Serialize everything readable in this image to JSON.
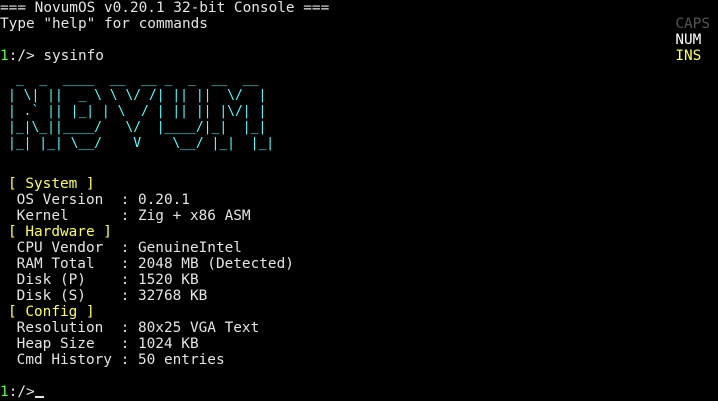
{
  "header": {
    "title": "=== NovumOS v0.20.1 32-bit Console ===",
    "help": "Type \"help\" for commands"
  },
  "indicators": {
    "caps": "CAPS",
    "num": "NUM",
    "ins": "INS"
  },
  "prompt": {
    "number": "1",
    "symbol": ":/> ",
    "command": "sysinfo"
  },
  "logo": {
    "lines": [
      " _  _  ____  __  __ _  _  __  __",
      "| \\| ||  _ \\ \\ \\/ /| || ||  \\/  |",
      "| .` || |_| | \\  / | || || |\\/| |",
      "|_|\\_||____/   \\/  |____/|_|  |_|",
      "|_| |_| \\__/    V    \\__/ |_|  |_|"
    ]
  },
  "sections": [
    {
      "title": "[ System ]",
      "rows": [
        {
          "label": " OS Version  ",
          "sep": ": ",
          "value": "0.20.1"
        },
        {
          "label": " Kernel      ",
          "sep": ": ",
          "value": "Zig + x86 ASM"
        }
      ]
    },
    {
      "title": "[ Hardware ]",
      "rows": [
        {
          "label": " CPU Vendor  ",
          "sep": ": ",
          "value": "GenuineIntel"
        },
        {
          "label": " RAM Total   ",
          "sep": ": ",
          "value": "2048 MB (Detected)"
        },
        {
          "label": " Disk (P)    ",
          "sep": ": ",
          "value": "1520 KB"
        },
        {
          "label": " Disk (S)    ",
          "sep": ": ",
          "value": "32768 KB"
        }
      ]
    },
    {
      "title": "[ Config ]",
      "rows": [
        {
          "label": " Resolution  ",
          "sep": ": ",
          "value": "80x25 VGA Text"
        },
        {
          "label": " Heap Size   ",
          "sep": ": ",
          "value": "1024 KB"
        },
        {
          "label": " Cmd History ",
          "sep": ": ",
          "value": "50 entries"
        }
      ]
    }
  ],
  "final_prompt": {
    "number": "1",
    "symbol": ":/>"
  },
  "colors": {
    "background": "#000000",
    "text": "#e4e4e4",
    "prompt_number": "#55ff55",
    "section_title": "#ffff55",
    "logo": "#55ffff",
    "indicator_off": "#555555",
    "indicator_highlight": "#ffff55"
  }
}
